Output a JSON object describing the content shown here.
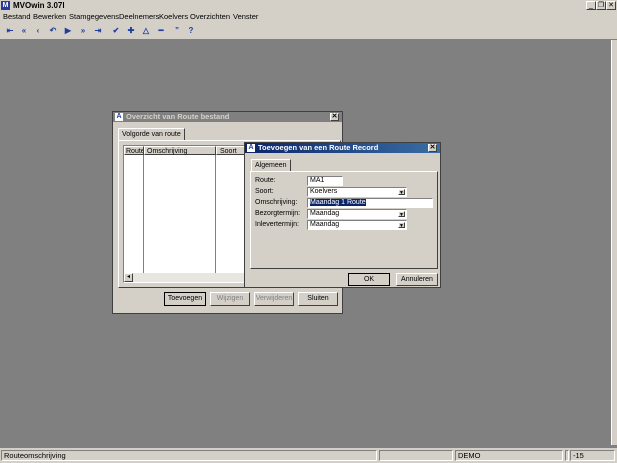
{
  "app": {
    "title": "MVOwin 3.07l",
    "icon_letter": "M"
  },
  "menu": [
    "Bestand",
    "Bewerken",
    "Stamgegevens",
    "Deelnemers",
    "Koelvers",
    "Overzichten",
    "Venster"
  ],
  "toolbar": {
    "icons": [
      "⇤",
      "«",
      "‹",
      "↶",
      "▶",
      "»",
      "⇥",
      "✔",
      "✚",
      "△",
      "━",
      "”",
      "?"
    ]
  },
  "overview": {
    "title": "Overzicht van Route bestand",
    "tab": "Volgorde van route",
    "columns": [
      "Route",
      "Omschrijving",
      "Soort Ro"
    ],
    "buttons": {
      "add": "Toevoegen",
      "edit": "Wijzigen",
      "delete": "Verwijderen",
      "close": "Sluiten"
    }
  },
  "record": {
    "title": "Toevoegen van een Route Record",
    "tab": "Algemeen",
    "labels": {
      "route": "Route:",
      "soort": "Soort:",
      "omschrijving": "Omschrijving:",
      "bezorg": "Bezorgtermijn:",
      "inlever": "Inlevertermijn:"
    },
    "values": {
      "route": "MA1",
      "soort": "Koelvers",
      "omschrijving": "Maandag 1 Route",
      "bezorg": "Maandag",
      "inlever": "Maandag"
    },
    "buttons": {
      "ok": "OK",
      "cancel": "Annuleren"
    }
  },
  "status": {
    "text": "Routeomschrijving",
    "mode": "DEMO",
    "code": "-15"
  },
  "colors": {
    "desktop": "#808080",
    "face": "#d4d0c8",
    "active_title": "#0a246a",
    "inactive_title": "#808080",
    "selection": "#0a246a"
  }
}
